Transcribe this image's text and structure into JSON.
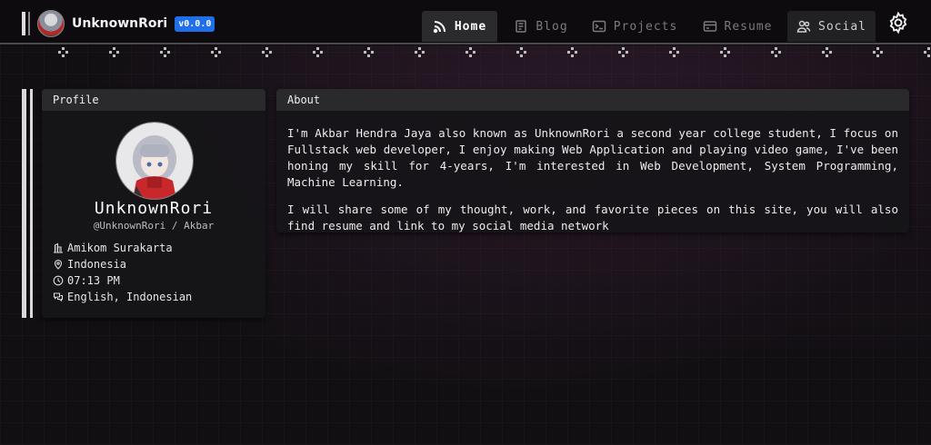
{
  "brand": {
    "name": "UnknownRori",
    "version": "v0.0.0"
  },
  "nav": {
    "home": "Home",
    "blog": "Blog",
    "projects": "Projects",
    "resume": "Resume",
    "social": "Social"
  },
  "icons": [
    "rss-icon",
    "document-icon",
    "terminal-icon",
    "card-icon",
    "users-icon",
    "gear-icon",
    "building-icon",
    "map-pin-icon",
    "clock-icon",
    "chat-icon"
  ],
  "profile": {
    "header": "Profile",
    "name": "UnknownRori",
    "handle": "@UnknownRori / Akbar",
    "location": "Amikom Surakarta",
    "country": "Indonesia",
    "time": "07:13 PM",
    "languages": "English, Indonesian"
  },
  "about": {
    "header": "About",
    "p1": "I'm Akbar Hendra Jaya also known as UnknownRori a second year college student, I focus on Fullstack web developer, I enjoy making Web Application and playing video game, I've been honing my skill for 4-years, I'm interested in Web Development, System Programming, Machine Learning.",
    "p2": "I will share some of my thought, work, and favorite pieces on this site, you will also find resume and link to my social media network"
  },
  "colors": {
    "accent": "#1f6feb",
    "background": "#110e12",
    "card": "#2a292c"
  }
}
